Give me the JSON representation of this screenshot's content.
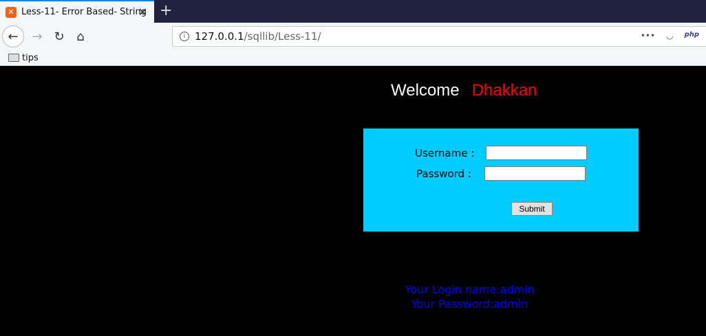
{
  "browser": {
    "tab_title": "Less-11- Error Based- String",
    "url_host": "127.0.0.1",
    "url_path": "/sqllib/Less-11/",
    "bookmark": "tips",
    "php_label": "php",
    "more_label": "•••"
  },
  "page": {
    "welcome": "Welcome",
    "name": "Dhakkan",
    "username_label": "Username :",
    "password_label": "Password :",
    "username_value": "",
    "password_value": "",
    "submit": "Submit",
    "login_name": "Your Login name:admin",
    "password_result": "Your Password:admin"
  }
}
